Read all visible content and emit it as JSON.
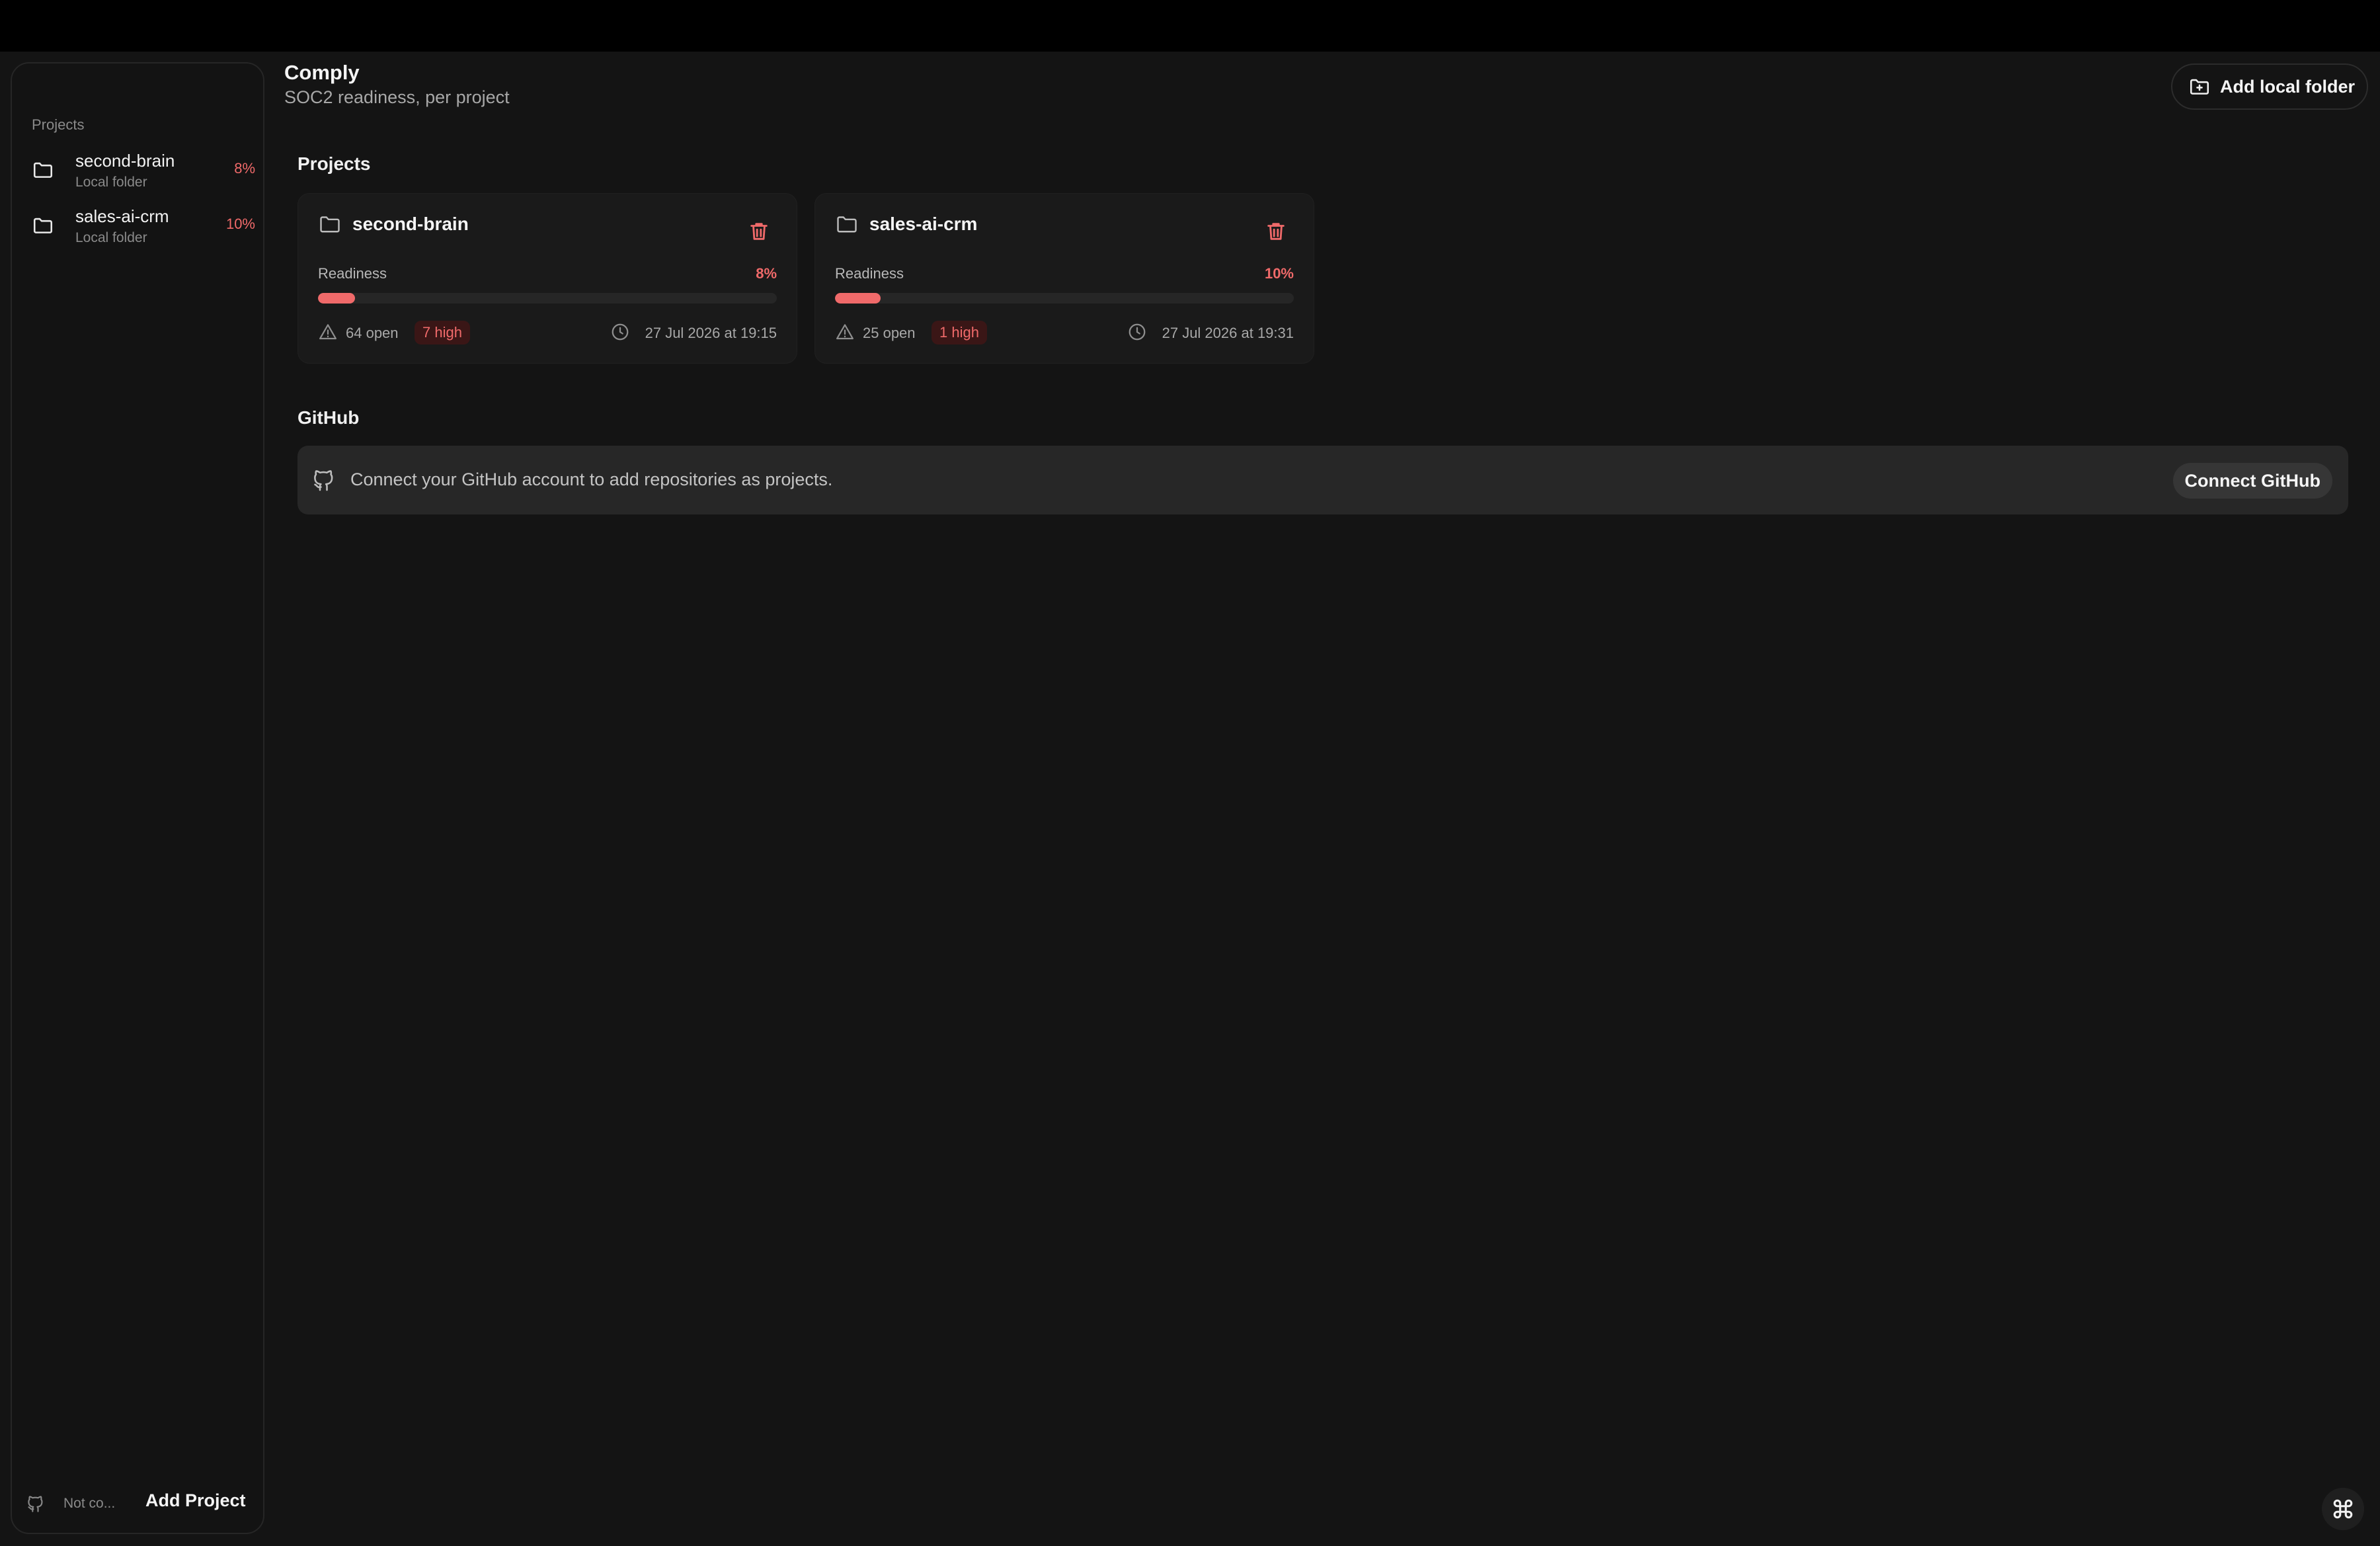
{
  "app": {
    "title": "Comply",
    "subtitle": "SOC2 readiness, per project"
  },
  "header": {
    "add_folder_label": "Add local folder"
  },
  "sidebar": {
    "heading": "Projects",
    "items": [
      {
        "name": "second-brain",
        "type": "Local folder",
        "readiness": "8%"
      },
      {
        "name": "sales-ai-crm",
        "type": "Local folder",
        "readiness": "10%"
      }
    ],
    "footer": {
      "github_status": "Not co...",
      "add_project_label": "Add Project"
    }
  },
  "projects": {
    "title": "Projects",
    "cards": [
      {
        "name": "second-brain",
        "readiness_label": "Readiness",
        "readiness": "8%",
        "readiness_value": 8,
        "open": "64 open",
        "high": "7 high",
        "updated": "27 Jul 2026 at 19:15"
      },
      {
        "name": "sales-ai-crm",
        "readiness_label": "Readiness",
        "readiness": "10%",
        "readiness_value": 10,
        "open": "25 open",
        "high": "1 high",
        "updated": "27 Jul 2026 at 19:31"
      }
    ]
  },
  "github": {
    "title": "GitHub",
    "message": "Connect your GitHub account to add repositories as projects.",
    "connect_label": "Connect GitHub"
  },
  "colors": {
    "accent": "#f06a6a",
    "background": "#141414",
    "card": "#1a1a1a"
  },
  "icons": [
    "folder-icon",
    "trash-icon",
    "warning-icon",
    "clock-icon",
    "github-icon",
    "folder-plus-icon",
    "command-icon"
  ]
}
